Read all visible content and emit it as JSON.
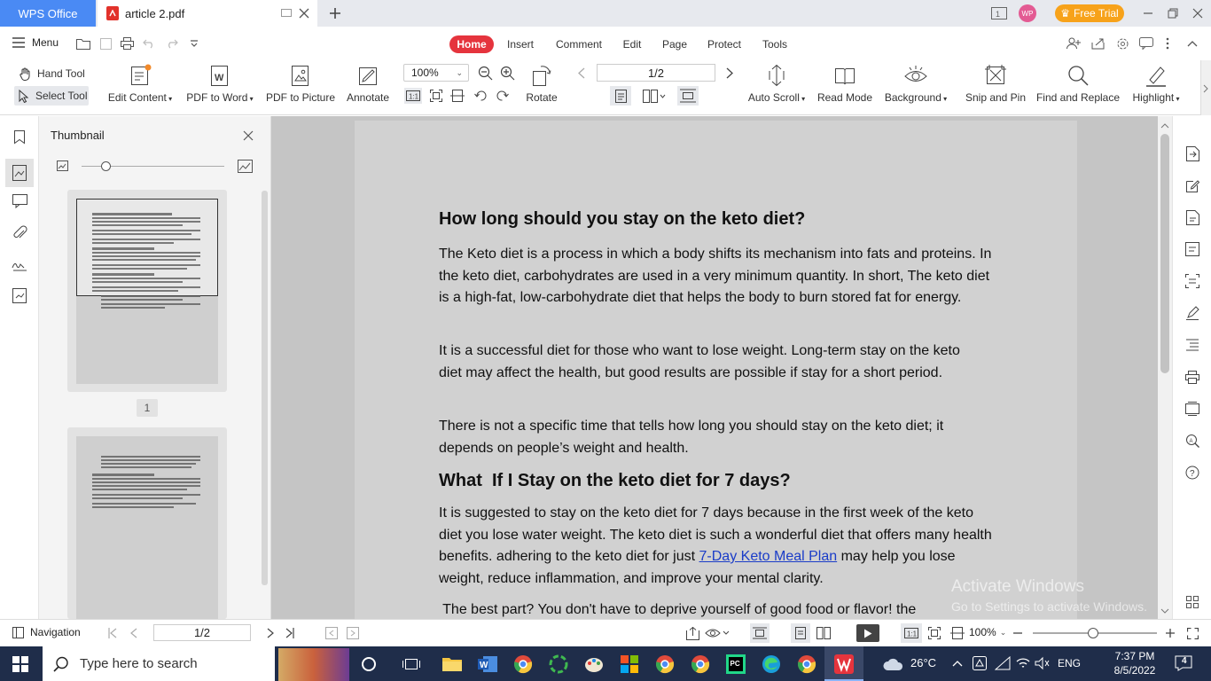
{
  "titlebar": {
    "app_tab": "WPS Office",
    "doc_tab": "article 2.pdf",
    "free_trial": "Free Trial",
    "avatar_initials": "WP"
  },
  "menu": {
    "menu_label": "Menu",
    "tabs": [
      "Home",
      "Insert",
      "Comment",
      "Edit",
      "Page",
      "Protect",
      "Tools"
    ]
  },
  "ribbon": {
    "hand_tool": "Hand Tool",
    "select_tool": "Select Tool",
    "edit_content": "Edit Content",
    "pdf_to_word": "PDF to Word",
    "pdf_to_picture": "PDF to Picture",
    "annotate": "Annotate",
    "zoom": "100%",
    "rotate": "Rotate",
    "page_box": "1/2",
    "auto_scroll": "Auto Scroll",
    "read_mode": "Read Mode",
    "background": "Background",
    "snip_and_pin": "Snip and Pin",
    "find_and_replace": "Find and Replace",
    "highlight": "Highlight"
  },
  "thumbnail": {
    "title": "Thumbnail",
    "page1_label": "1"
  },
  "document": {
    "heading1": "How long should you stay on the keto diet?",
    "para1": "The Keto diet is a process in which a body shifts its mechanism into fats and proteins. In the keto diet, carbohydrates are used in a very minimum quantity. In short, The keto diet is a high-fat, low-carbohydrate diet that helps the body to burn stored fat for energy.",
    "para2": "It is a successful diet for those who want to lose weight. Long-term stay on the keto diet may affect the health, but good results are possible if stay for a short period.",
    "para3": "There is not a specific time that tells how long you should stay on the keto diet; it depends on people’s weight and health.",
    "heading2": "What  If I Stay on the keto diet for 7 days?",
    "para4_a": "It is suggested to stay on the keto diet for 7 days because in the first week of the keto diet you lose water weight. The keto diet is such a wonderful diet that offers many health benefits. adhering to the keto diet for just ",
    "para4_link": "7-Day Keto Meal Plan",
    "para4_b": " may help you lose weight, reduce inflammation, and improve your mental clarity.",
    "para5": " The best part? You don't have to deprive yourself of good food or flavor! the"
  },
  "watermark": {
    "line1": "Activate Windows",
    "line2": "Go to Settings to activate Windows."
  },
  "statusbar": {
    "navigation": "Navigation",
    "page_box": "1/2",
    "zoom": "100%"
  },
  "taskbar": {
    "search_placeholder": "Type here to search",
    "weather": "26°C",
    "language": "ENG",
    "time": "7:37 PM",
    "date": "8/5/2022",
    "notifications": "4"
  },
  "colors": {
    "accent_blue": "#4a8af4",
    "home_red": "#e5343d",
    "free_trial": "#f7a21a",
    "taskbar": "#1f2d4a"
  }
}
